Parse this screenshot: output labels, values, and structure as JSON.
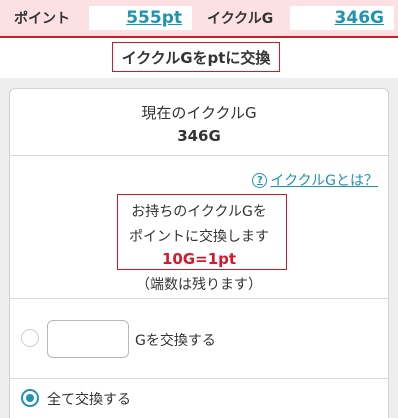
{
  "balance": {
    "points_label": "ポイント",
    "points_value": "555pt",
    "ikukuru_label": "イククルG",
    "ikukuru_value": "346G"
  },
  "page_title": "イククルGをptに交換",
  "current": {
    "label": "現在のイククルG",
    "value": "346G"
  },
  "info": {
    "help_link": "イククルGとは？",
    "help_icon": "question-circle-icon",
    "line1": "お持ちのイククルGを",
    "line2": "ポイントに交換します",
    "rate": "10G=1pt",
    "note": "（端数は残ります）"
  },
  "exchange": {
    "amount_value": "",
    "amount_suffix": "Gを交換する",
    "all_label": "全て交換する",
    "selected_option": "all"
  },
  "colors": {
    "accent_red": "#d8182a",
    "link_blue": "#1e95b0",
    "header_pink": "#fbe1e4"
  }
}
